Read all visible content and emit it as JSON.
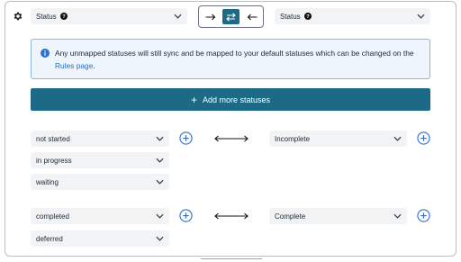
{
  "left_header_select": {
    "label": "Status"
  },
  "right_header_select": {
    "label": "Status"
  },
  "direction": {
    "options": [
      "to-right",
      "both",
      "to-left"
    ],
    "selected": "both"
  },
  "info": {
    "text_before": "Any unmapped statuses will still sync and be mapped to your default statuses which can be changed on the ",
    "link_text": "Rules page",
    "text_after": "."
  },
  "add_button": {
    "label": "Add more statuses"
  },
  "mappings": [
    {
      "left": [
        "not started",
        "in progress",
        "waiting"
      ],
      "right": "Incomplete"
    },
    {
      "left": [
        "completed",
        "deferred"
      ],
      "right": "Complete"
    }
  ],
  "colors": {
    "primary": "#1d6a86",
    "info_bg": "#eef5fd",
    "info_border": "#8ab6e8",
    "link": "#1a6fd8",
    "plus_icon": "#2f6fd0"
  }
}
